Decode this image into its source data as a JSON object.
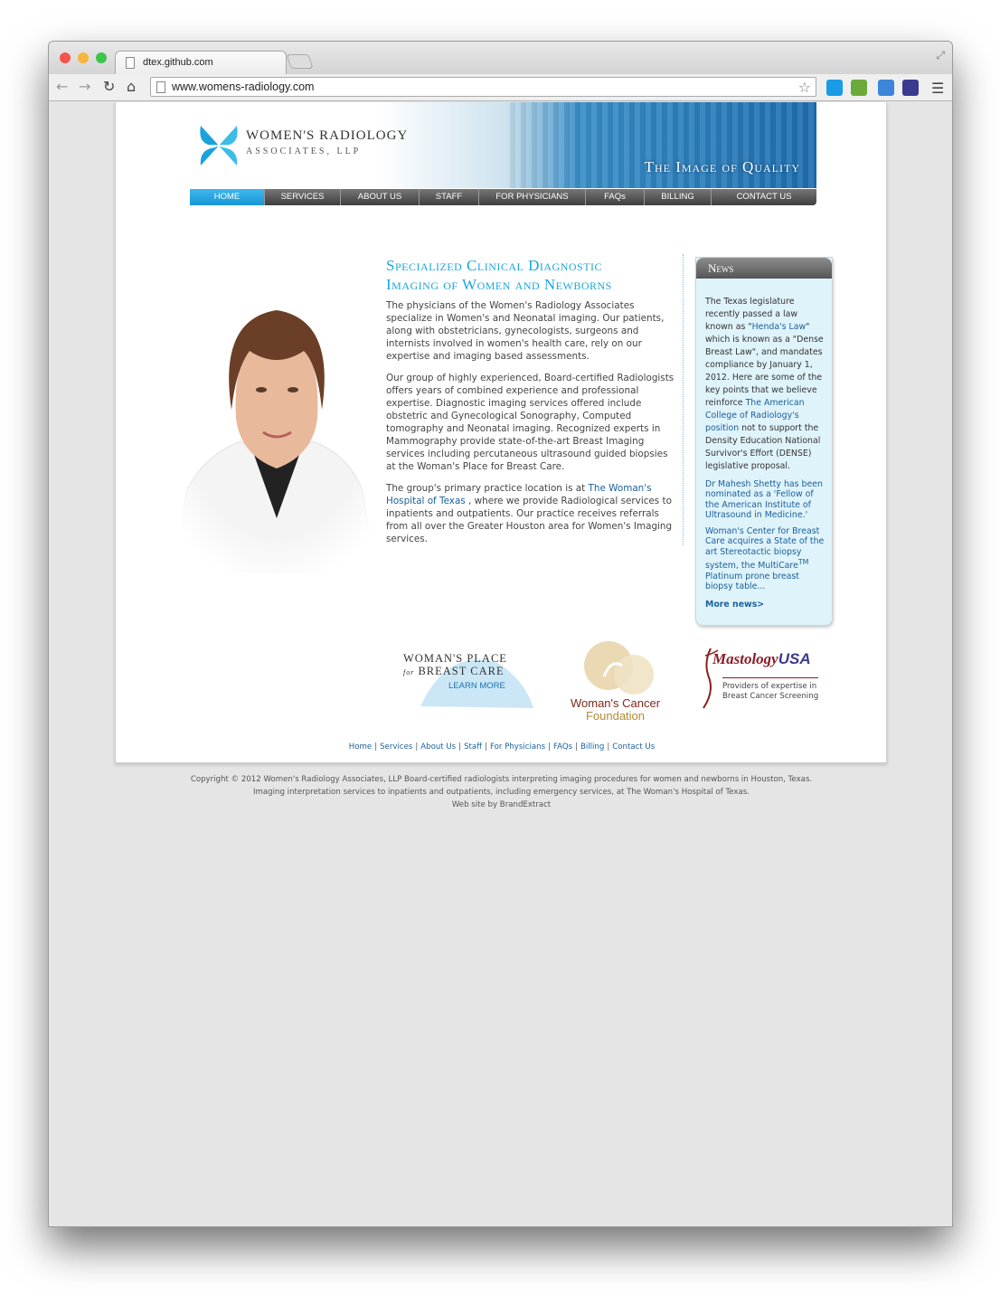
{
  "browser": {
    "tab_title": "dtex.github.com",
    "url": "www.womens-radiology.com",
    "traffic_lights": [
      "#f4544c",
      "#f8b53b",
      "#3ec44b"
    ],
    "icons": [
      "back-icon",
      "forward-icon",
      "reload-icon",
      "home-icon",
      "bookmark-star-icon",
      "menu-icon"
    ]
  },
  "site": {
    "logo_line1": "WOMEN'S RADIOLOGY",
    "logo_line2": "ASSOCIATES, LLP",
    "tagline": "The Image of Quality",
    "nav": [
      "HOME",
      "SERVICES",
      "ABOUT US",
      "STAFF",
      "FOR PHYSICIANS",
      "FAQs",
      "BILLING",
      "CONTACT US"
    ],
    "active_nav": "HOME",
    "accent_color": "#19a6dc"
  },
  "main": {
    "heading_line1": "Specialized Clinical Diagnostic",
    "heading_line2": "Imaging of Women and Newborns",
    "para1": "The physicians of the Women's Radiology Associates specialize in Women's and Neonatal imaging. Our patients, along with obstetricians, gynecologists, surgeons and internists involved in women's health care, rely on our expertise and imaging based assessments.",
    "para2": "Our group of highly experienced, Board-certified Radiologists offers years of combined experience and professional expertise. Diagnostic imaging services offered include obstetric and Gynecological Sonography, Computed tomography and Neonatal imaging. Recognized experts in Mammography provide state-of-the-art Breast Imaging services including percutaneous ultrasound guided biopsies at the Woman's Place for Breast Care.",
    "para3_before": "The group's primary practice location is at ",
    "para3_link": "The Woman's Hospital of Texas",
    "para3_after": " , where we provide Radiological services to inpatients and outpatients. Our practice receives referrals from all over the Greater Houston area for Women's Imaging services."
  },
  "news": {
    "title": "News",
    "item1_a": "The Texas legislature recently passed a law known as \"",
    "item1_link1": "Henda's Law",
    "item1_b": "\" which is known as a \"Dense Breast Law\", and mandates compliance by January 1, 2012. Here are some of the key points that we believe reinforce ",
    "item1_link2": "The American College of Radiology's position",
    "item1_c": " not to support the Density Education National Survivor's Effort (DENSE) legislative proposal.",
    "item2": "Dr Mahesh Shetty has been nominated as a 'Fellow of the American Institute of Ultrasound in Medicine.'",
    "item3_a": "Woman's Center for Breast Care acquires a State of the art Stereotactic biopsy system, the MultiCare",
    "item3_tm": "TM",
    "item3_b": " Platinum prone breast biopsy table...",
    "more": "More news>"
  },
  "partners": {
    "wp_line1": "WOMAN'S PLACE",
    "wp_for": "for",
    "wp_line2": "BREAST CARE",
    "wp_learn": "LEARN MORE",
    "wcf_line1": "Woman's Cancer",
    "wcf_line2": "Foundation",
    "mastology_a": "Mastology",
    "mastology_b": "USA",
    "mastology_tag1": "Providers of expertise in",
    "mastology_tag2": "Breast Cancer Screening"
  },
  "footer": {
    "links": [
      "Home",
      "Services",
      "About Us",
      "Staff",
      "For Physicians",
      "FAQs",
      "Billing",
      "Contact Us"
    ],
    "copyright1": "Copyright © 2012 Women's Radiology Associates, LLP Board-certified radiologists interpreting imaging procedures for women and newborns in Houston, Texas.",
    "copyright2": "Imaging interpretation services to inpatients and outpatients, including emergency services, at The Woman's Hospital of Texas.",
    "credit": "Web site by BrandExtract"
  }
}
